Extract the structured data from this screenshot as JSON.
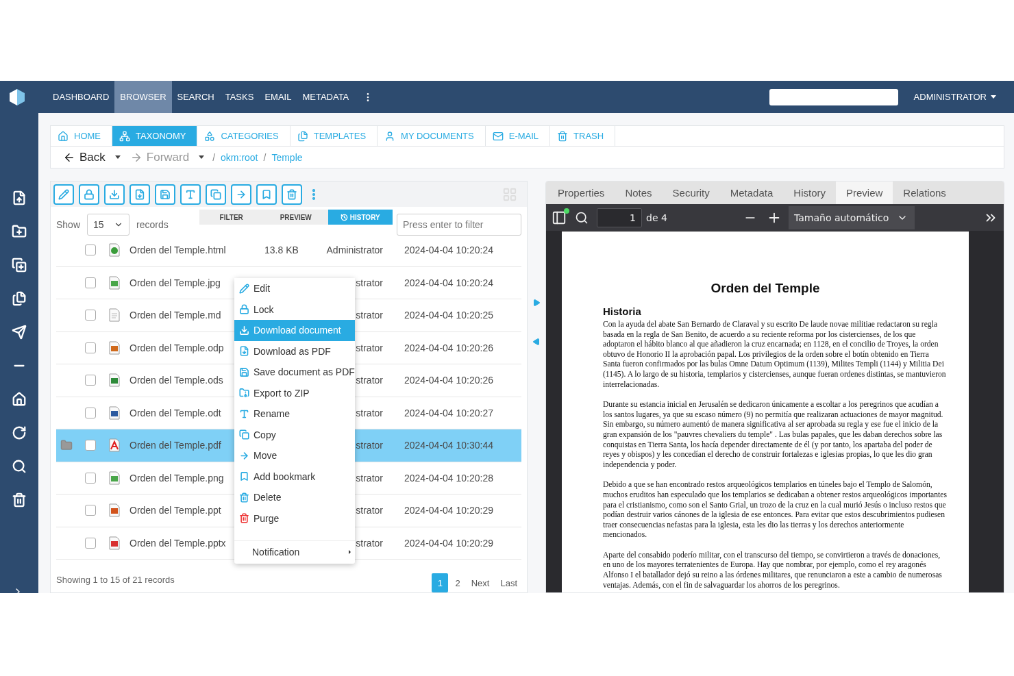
{
  "navbar": {
    "items": [
      {
        "label": "DASHBOARD",
        "selected": false
      },
      {
        "label": "BROWSER",
        "selected": true
      },
      {
        "label": "SEARCH",
        "selected": false
      },
      {
        "label": "TASKS",
        "selected": false
      },
      {
        "label": "EMAIL",
        "selected": false
      },
      {
        "label": "METADATA",
        "selected": false
      }
    ],
    "user": "ADMINISTRATOR"
  },
  "tabs": [
    {
      "label": "HOME",
      "selected": false
    },
    {
      "label": "TAXONOMY",
      "selected": true
    },
    {
      "label": "CATEGORIES",
      "selected": false
    },
    {
      "label": "TEMPLATES",
      "selected": false
    },
    {
      "label": "MY DOCUMENTS",
      "selected": false
    },
    {
      "label": "E-MAIL",
      "selected": false
    },
    {
      "label": "TRASH",
      "selected": false
    }
  ],
  "navigation": {
    "back": {
      "label": "Back",
      "disabled": false
    },
    "forward": {
      "label": "Forward",
      "disabled": true
    },
    "path": [
      {
        "separator": "/",
        "label": "okm:root"
      },
      {
        "separator": "/",
        "label": "Temple"
      }
    ]
  },
  "browser": {
    "view_tabs": [
      {
        "label": "FILTER",
        "selected": false
      },
      {
        "label": "PREVIEW",
        "selected": false
      },
      {
        "label": "HISTORY",
        "selected": true
      }
    ],
    "show_label": "Show",
    "page_size": "15",
    "records_label": "records",
    "filter": {
      "placeholder": "Press enter to filter"
    },
    "rows": [
      {
        "name": "Orden del Temple.html",
        "kind": "html",
        "size": "13.8 KB",
        "author": "Administrator",
        "date": "2024-04-04 10:20:24",
        "selected": false,
        "flagged": false
      },
      {
        "name": "Orden del Temple.jpg",
        "kind": "image",
        "author": "strator",
        "date": "2024-04-04 10:20:24",
        "selected": false,
        "flagged": false
      },
      {
        "name": "Orden del Temple.md",
        "kind": "text",
        "author": "strator",
        "date": "2024-04-04 10:20:25",
        "selected": false,
        "flagged": false
      },
      {
        "name": "Orden del Temple.odp",
        "kind": "presentation",
        "author": "strator",
        "date": "2024-04-04 10:20:26",
        "selected": false,
        "flagged": false
      },
      {
        "name": "Orden del Temple.ods",
        "kind": "spreadsheet",
        "author": "strator",
        "date": "2024-04-04 10:20:26",
        "selected": false,
        "flagged": false
      },
      {
        "name": "Orden del Temple.odt",
        "kind": "document",
        "author": "strator",
        "date": "2024-04-04 10:20:27",
        "selected": false,
        "flagged": false
      },
      {
        "name": "Orden del Temple.pdf",
        "kind": "pdf",
        "author": "strator",
        "date": "2024-04-04 10:30:44",
        "selected": true,
        "flagged": true
      },
      {
        "name": "Orden del Temple.png",
        "kind": "image",
        "author": "strator",
        "date": "2024-04-04 10:20:28",
        "selected": false,
        "flagged": false
      },
      {
        "name": "Orden del Temple.ppt",
        "kind": "ppt",
        "author": "strator",
        "date": "2024-04-04 10:20:29",
        "selected": false,
        "flagged": false
      },
      {
        "name": "Orden del Temple.pptx",
        "kind": "pptx",
        "author": "strator",
        "date": "2024-04-04 10:20:29",
        "selected": false,
        "flagged": false
      }
    ],
    "context_menu": [
      {
        "label": "Edit",
        "kind": "action",
        "selected": false
      },
      {
        "label": "Lock",
        "kind": "action",
        "selected": false
      },
      {
        "label": "Download document",
        "kind": "action",
        "selected": true
      },
      {
        "label": "Download as PDF",
        "kind": "action",
        "selected": false
      },
      {
        "label": "Save document as PDF",
        "kind": "action",
        "selected": false
      },
      {
        "label": "Export to ZIP",
        "kind": "action",
        "selected": false
      },
      {
        "label": "Rename",
        "kind": "action",
        "selected": false
      },
      {
        "label": "Copy",
        "kind": "action",
        "selected": false
      },
      {
        "label": "Move",
        "kind": "action",
        "selected": false
      },
      {
        "label": "Add bookmark",
        "kind": "action",
        "selected": false
      },
      {
        "label": "Delete",
        "kind": "action",
        "selected": false
      },
      {
        "label": "Purge",
        "kind": "action",
        "selected": false
      },
      {
        "label": "Notification",
        "kind": "submenu",
        "selected": false
      }
    ],
    "footer": "Showing 1 to 15 of 21 records",
    "pagination": [
      {
        "label": "1",
        "selected": true
      },
      {
        "label": "2",
        "selected": false
      },
      {
        "label": "Next",
        "selected": false
      },
      {
        "label": "Last",
        "selected": false
      }
    ]
  },
  "details": {
    "tabs": [
      {
        "label": "Properties",
        "selected": false
      },
      {
        "label": "Notes",
        "selected": false
      },
      {
        "label": "Security",
        "selected": false
      },
      {
        "label": "Metadata",
        "selected": false
      },
      {
        "label": "History",
        "selected": false
      },
      {
        "label": "Preview",
        "selected": true
      },
      {
        "label": "Relations",
        "selected": false
      }
    ],
    "viewer": {
      "page": "1",
      "page_count": "de 4",
      "zoom": "Tamaño automático",
      "title": "Orden del Temple",
      "heading": "Historia",
      "paragraphs": [
        "Con la ayuda del abate San Bernardo de Claraval y su escrito De laude novae militiae redactaron su regla basada en la regla de San Benito, de acuerdo a su reciente reforma por los cistercienses, de los que adoptaron el hábito blanco al que añadieron la cruz encarnada; en 1128, en el concilio de Troyes, la orden obtuvo de Honorio II la aprobación papal. Los privilegios de la orden sobre el botín obtenido en Tierra Santa fueron confirmados por las bulas Omne Datum Optimum (1139), Milites Templi (1144) y Militia Dei (1145). A lo largo de su historia, templarios y cistercienses, aunque fueran ordenes distintas, se mantuvieron interrelacionadas.",
        "Durante su estancia inicial en Jerusalén se dedicaron únicamente a escoltar a los peregrinos que acudían a los santos lugares, ya que su escaso número (9) no permitía que realizaran actuaciones de mayor magnitud. Sin embargo, su número aumentó de manera significativa al ser aprobada su regla y ese fue el inicio de la gran expansión de los \"pauvres chevaliers du temple\" . Las bulas papales, que les daban derechos sobre las conquistas en Tierra Santa, los hacía depender directamente de él (y por tanto, los apartaba del poder de reyes y obispos) y les concedían el derecho de construir fortalezas e iglesias propias, lo que les dio gran independencia y poder.",
        "Debido a que se han encontrado restos arqueológicos templarios en túneles bajo el Templo de Salomón, muchos eruditos han especulado que los templarios se dedicaban a obtener restos arqueológicos importantes para el cristianismo, como son el Santo Grial, un trozo de la cruz en la cual murió Jesús o incluso restos que podían destruir varios cánones de la iglesia de ese entonces. Para evitar que estos descubrimientos pudiesen traer consecuencias nefastas para la iglesia, esta les dio las tierras y los derechos anteriormente mencionados.",
        "Aparte del consabido poderío militar, con el transcurso del tiempo, se convirtieron a través de donaciones, en uno de los mayores terratenientes de Europa. Hay que nombrar, por ejemplo, como el rey aragonés Alfonso I el batallador dejó su reino a las órdenes militares, que renunciaron a este a cambio de numerosas ventajas. Además, con el fin de salvaguardar los ahorros de los peregrinos."
      ]
    }
  }
}
